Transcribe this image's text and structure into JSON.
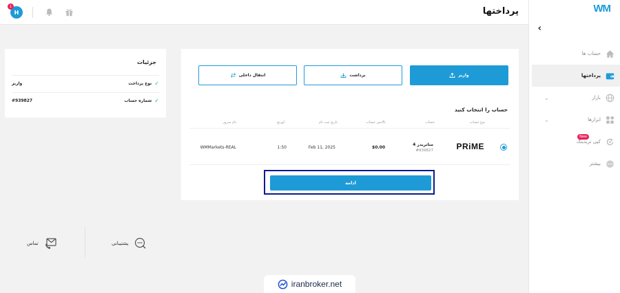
{
  "app": {
    "logo": "WM",
    "page_title": "پرداختها"
  },
  "topbar": {
    "avatar_initial": "H",
    "notification_count": "1"
  },
  "sidebar": {
    "items": [
      {
        "label": "حساب ها",
        "icon": "home-icon",
        "active": false,
        "has_chevron": false
      },
      {
        "label": "پرداختها",
        "icon": "wallet-icon",
        "active": true,
        "has_chevron": false
      },
      {
        "label": "بازار",
        "icon": "globe-icon",
        "active": false,
        "has_chevron": true
      },
      {
        "label": "ابزارها",
        "icon": "grid-icon",
        "active": false,
        "has_chevron": true
      },
      {
        "label": "کپی تریدینگ",
        "icon": "copy-trading-icon",
        "active": false,
        "has_chevron": false,
        "badge": "New"
      },
      {
        "label": "بیشتر",
        "icon": "more-icon",
        "active": false,
        "has_chevron": false
      }
    ]
  },
  "details": {
    "title": "جزئیات",
    "rows": [
      {
        "label": "نوع پرداخت",
        "value": "واریز"
      },
      {
        "label": "شماره حساب",
        "value": "#939827"
      }
    ]
  },
  "payment": {
    "tabs": [
      {
        "label": "واریز",
        "icon": "upload-icon",
        "active": true
      },
      {
        "label": "برداشت",
        "icon": "download-icon",
        "active": false
      },
      {
        "label": "انتقال داخلی",
        "icon": "transfer-icon",
        "active": false
      }
    ],
    "section_title": "حساب را انتخاب کنید",
    "columns": [
      "نوع حساب",
      "حساب",
      "بالانس حساب",
      "تاریخ ثبت نام",
      "لوریج",
      "نام سرور"
    ],
    "row": {
      "type_logo": "PRiME",
      "account_name": "متاتریدر 4",
      "account_number": "#939827",
      "balance": "$0.00",
      "date": "Feb 11, 2025",
      "leverage": "1:50",
      "server": "WMMarkets-REAL",
      "selected": true
    },
    "continue_label": "ادامه"
  },
  "support": {
    "support_label": "پشتیبانی",
    "contact_label": "تماس"
  },
  "watermark": "iranbroker.net",
  "colors": {
    "accent": "#1e9bd7",
    "highlight_border": "#0a1a8c",
    "badge": "#e5245a",
    "check": "#2aa876"
  }
}
